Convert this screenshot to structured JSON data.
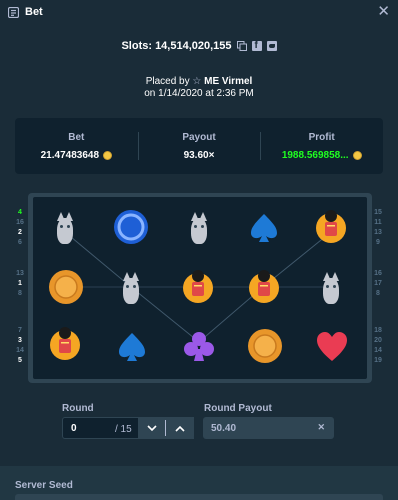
{
  "header": {
    "title": "Bet"
  },
  "slots": {
    "label": "Slots: 14,514,020,155"
  },
  "placed": {
    "prefix": "Placed by",
    "user": "ME Virmel",
    "date": "on 1/14/2020 at 2:36 PM"
  },
  "stats": {
    "bet_label": "Bet",
    "bet_value": "21.47483648",
    "payout_label": "Payout",
    "payout_value": "93.60×",
    "profit_label": "Profit",
    "profit_value": "1988.569858...",
    "profit_color": "#1fff20"
  },
  "reels": {
    "left_numbers": [
      "4",
      "16",
      "2",
      "6",
      "13",
      "1",
      "8",
      "7",
      "3",
      "14",
      "5"
    ],
    "right_numbers": [
      "15",
      "11",
      "13",
      "9",
      "16",
      "17",
      "8",
      "18",
      "20",
      "14",
      "19"
    ],
    "grid": [
      [
        "wolf-icon",
        "blue-chip-icon",
        "wolf-icon",
        "spade-icon",
        "scarab-icon"
      ],
      [
        "gold-coin-icon",
        "wolf-icon",
        "scarab-icon",
        "scarab-icon",
        "wolf-icon"
      ],
      [
        "scarab-icon",
        "spade-icon",
        "club-icon",
        "gold-coin-icon",
        "heart-icon"
      ]
    ]
  },
  "controls": {
    "round_label": "Round",
    "round_value": "0",
    "round_total": "/ 15",
    "round_payout_label": "Round Payout",
    "round_payout_value": "50.40"
  },
  "footer": {
    "server_seed_label": "Server Seed"
  }
}
